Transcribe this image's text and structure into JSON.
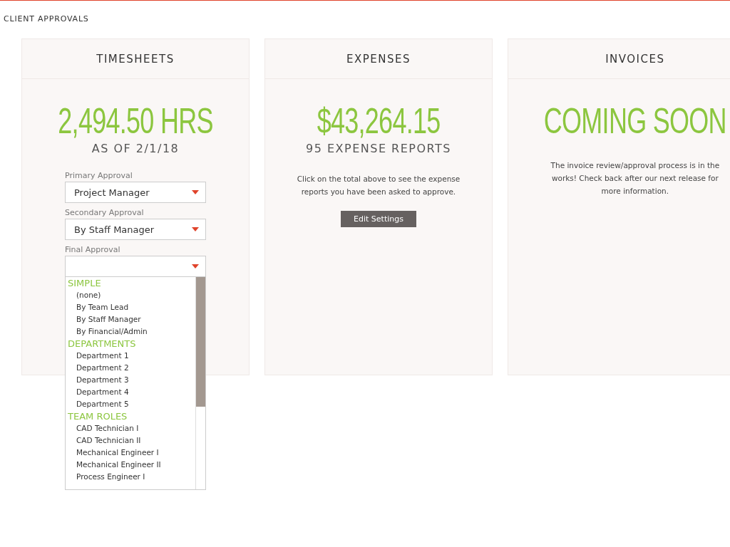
{
  "page_title": "CLIENT APPROVALS",
  "cards": [
    {
      "title": "TIMESHEETS",
      "total": "2,494.50 HRS",
      "subtitle": "AS OF 2/1/18",
      "selects": [
        {
          "label": "Primary Approval",
          "value": "Project Manager"
        },
        {
          "label": "Secondary Approval",
          "value": "By Staff Manager"
        },
        {
          "label": "Final Approval",
          "open": true,
          "groups": [
            {
              "heading": "SIMPLE",
              "options": [
                "(none)",
                "By Team Lead",
                "By Staff Manager",
                "By Financial/Admin"
              ]
            },
            {
              "heading": "DEPARTMENTS",
              "options": [
                "Department 1",
                "Department 2",
                "Department 3",
                "Department 4",
                "Department 5"
              ]
            },
            {
              "heading": "TEAM ROLES",
              "options": [
                "CAD Technician I",
                "CAD Technician II",
                "Mechanical Engineer I",
                "Mechanical Engineer II",
                "Process Engineer I"
              ]
            }
          ]
        }
      ]
    },
    {
      "title": "EXPENSES",
      "total": "$43,264.15",
      "subtitle": "95 EXPENSE REPORTS",
      "description": "Click on the total above to see the expense reports you have been asked to approve.",
      "button": "Edit Settings"
    },
    {
      "title": "INVOICES",
      "total": "COMING SOON",
      "description": "The invoice review/approval process is in the works! Check back after our next release for more information."
    }
  ]
}
